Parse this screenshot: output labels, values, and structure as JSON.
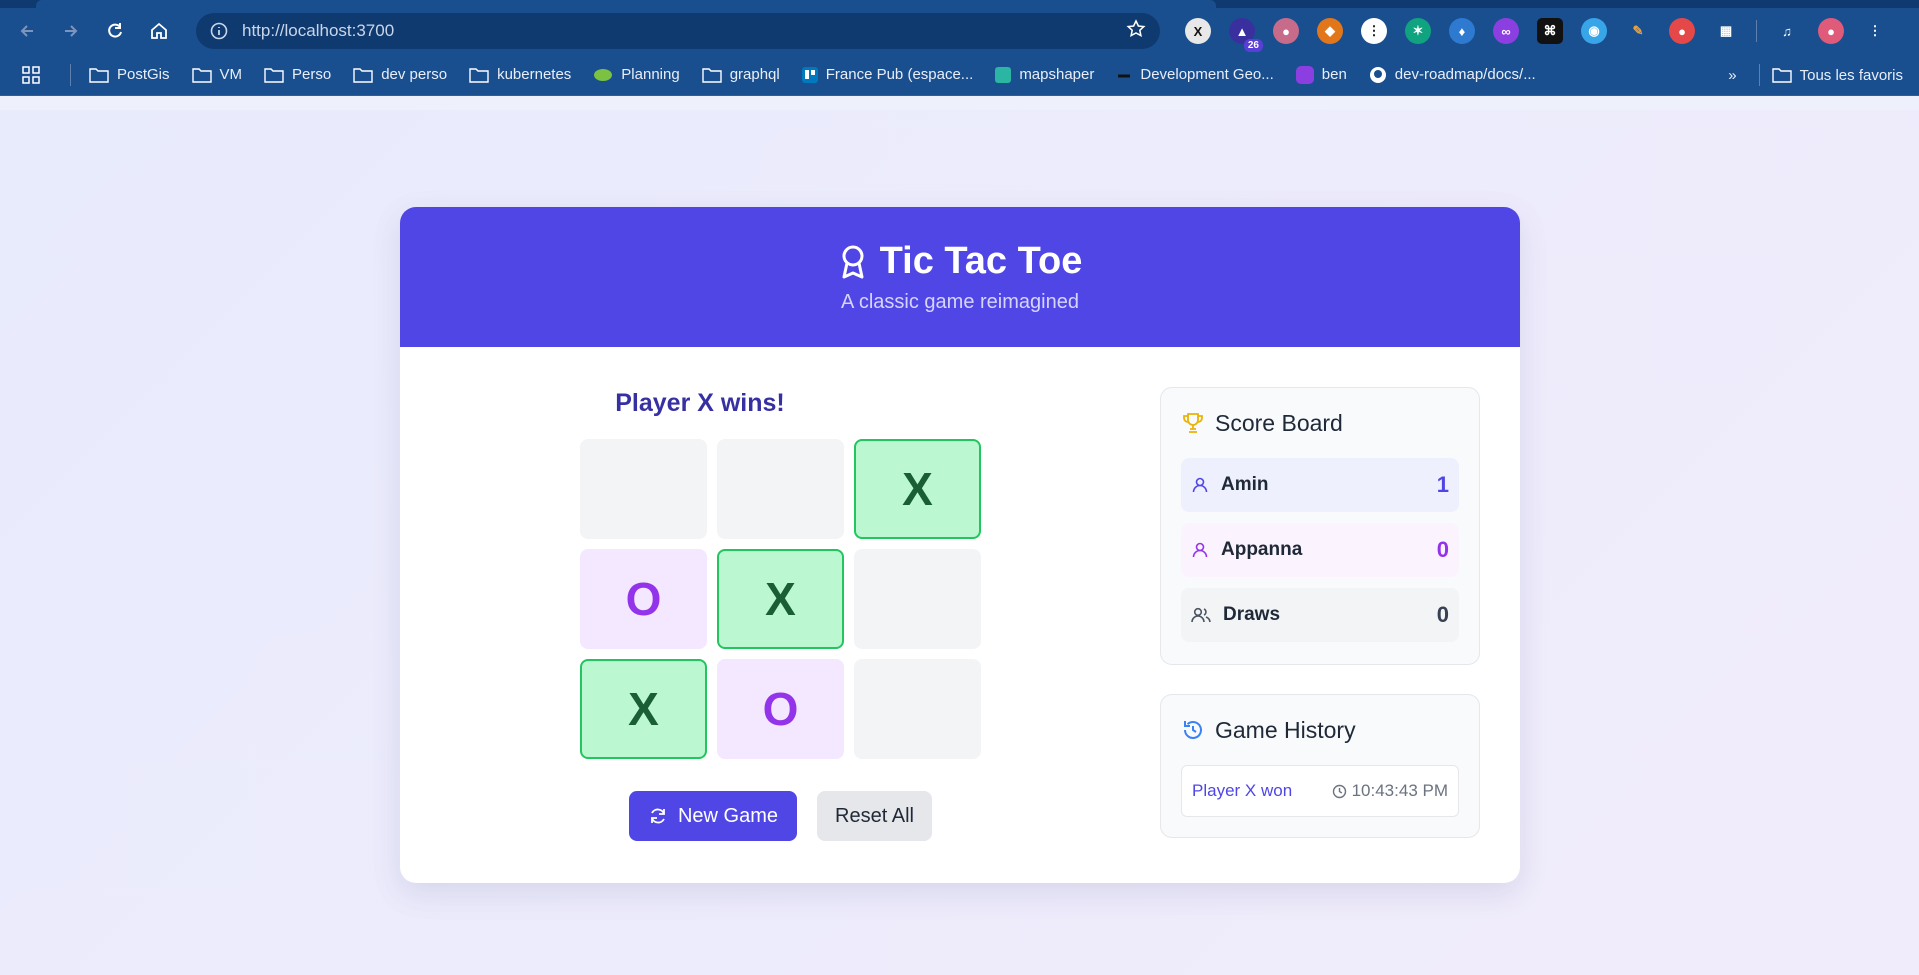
{
  "browser": {
    "url": "http://localhost:3700",
    "extension_badge": "26",
    "bookmarks": [
      {
        "label": "PostGis",
        "icon": "folder-icon"
      },
      {
        "label": "VM",
        "icon": "folder-icon"
      },
      {
        "label": "Perso",
        "icon": "folder-icon"
      },
      {
        "label": "dev perso",
        "icon": "folder-icon"
      },
      {
        "label": "kubernetes",
        "icon": "folder-icon"
      },
      {
        "label": "Planning",
        "icon": "planning-icon"
      },
      {
        "label": "graphql",
        "icon": "folder-icon"
      },
      {
        "label": "France Pub (espace...",
        "icon": "trello-icon"
      },
      {
        "label": "mapshaper",
        "icon": "mapshaper-icon"
      },
      {
        "label": "Development Geo...",
        "icon": "dev-icon"
      },
      {
        "label": "ben",
        "icon": "ben-icon"
      },
      {
        "label": "dev-roadmap/docs/...",
        "icon": "github-icon"
      }
    ],
    "all_bookmarks": "Tous les favoris"
  },
  "game": {
    "title": "Tic Tac Toe",
    "subtitle": "A classic game reimagined",
    "status": "Player X wins!",
    "board": [
      {
        "value": "",
        "win": false
      },
      {
        "value": "",
        "win": false
      },
      {
        "value": "X",
        "win": true
      },
      {
        "value": "O",
        "win": false
      },
      {
        "value": "X",
        "win": true
      },
      {
        "value": "",
        "win": false
      },
      {
        "value": "X",
        "win": true
      },
      {
        "value": "O",
        "win": false
      },
      {
        "value": "",
        "win": false
      }
    ],
    "new_game_label": "New Game",
    "reset_label": "Reset All"
  },
  "scoreboard": {
    "title": "Score Board",
    "rows": [
      {
        "name": "Amin",
        "score": "1"
      },
      {
        "name": "Appanna",
        "score": "0"
      },
      {
        "name": "Draws",
        "score": "0"
      }
    ]
  },
  "history": {
    "title": "Game History",
    "items": [
      {
        "result": "Player X won",
        "time": "10:43:43 PM"
      }
    ]
  },
  "colors": {
    "accent": "#4f46e5",
    "player_o": "#9333ea",
    "win_bg": "#bbf7d0",
    "win_border": "#22c55e"
  }
}
